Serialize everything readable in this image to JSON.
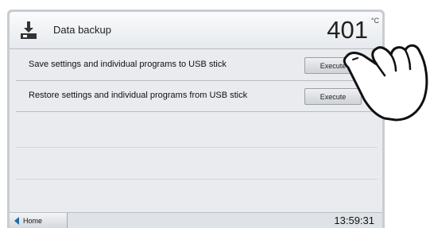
{
  "header": {
    "icon": "download-icon",
    "title": "Data backup",
    "temperature": "401",
    "temperature_unit": "°C"
  },
  "actions": [
    {
      "label": "Save settings and individual programs to USB stick",
      "button": "Execute"
    },
    {
      "label": "Restore settings and individual programs from USB stick",
      "button": "Execute"
    }
  ],
  "footer": {
    "home_label": "Home",
    "home_icon": "arrow-left-icon",
    "time": "13:59:31"
  },
  "colors": {
    "accent": "#1c6ea8",
    "background": "#e9ebee"
  }
}
